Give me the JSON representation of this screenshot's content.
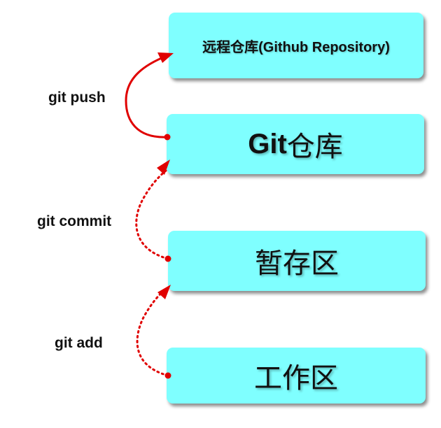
{
  "boxes": {
    "remote": "远程仓库(Github Repository)",
    "repo_git": "Git",
    "repo_cn": "仓库",
    "stage": "暂存区",
    "work": "工作区"
  },
  "commands": {
    "push": "git push",
    "commit": "git commit",
    "add": "git add"
  },
  "colors": {
    "box_fill": "#7fffff",
    "arrow": "#e00000"
  }
}
